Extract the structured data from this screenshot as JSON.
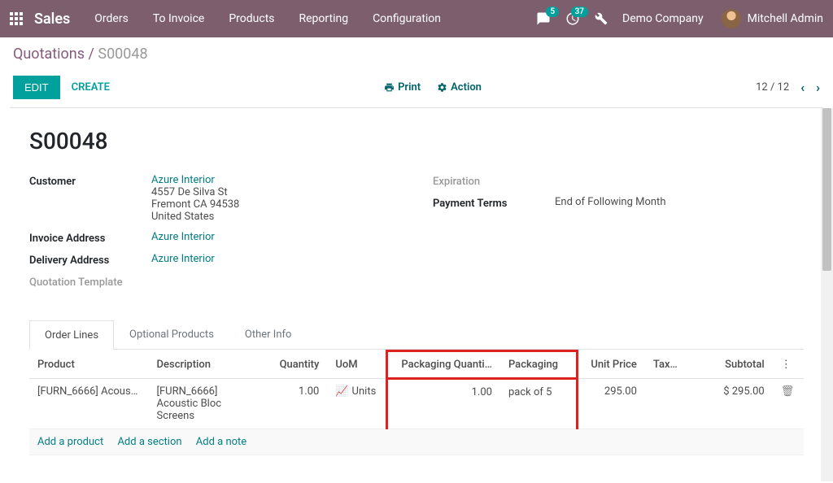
{
  "nav": {
    "brand": "Sales",
    "items": [
      "Orders",
      "To Invoice",
      "Products",
      "Reporting",
      "Configuration"
    ],
    "msg_badge": "5",
    "activity_badge": "37",
    "company": "Demo Company",
    "user": "Mitchell Admin"
  },
  "breadcrumb": {
    "root": "Quotations",
    "sep": " / ",
    "current": "S00048"
  },
  "buttons": {
    "edit": "EDIT",
    "create": "CREATE",
    "print": "Print",
    "action": "Action"
  },
  "pager": {
    "text": "12 / 12"
  },
  "record": {
    "title": "S00048",
    "customer_label": "Customer",
    "customer_link": "Azure Interior",
    "customer_addr1": "4557 De Silva St",
    "customer_addr2": "Fremont CA 94538",
    "customer_addr3": "United States",
    "invoice_label": "Invoice Address",
    "invoice_link": "Azure Interior",
    "delivery_label": "Delivery Address",
    "delivery_link": "Azure Interior",
    "template_label": "Quotation Template",
    "expiration_label": "Expiration",
    "terms_label": "Payment Terms",
    "terms_value": "End of Following Month"
  },
  "tabs": [
    "Order Lines",
    "Optional Products",
    "Other Info"
  ],
  "table": {
    "headers": {
      "product": "Product",
      "description": "Description",
      "quantity": "Quantity",
      "uom": "UoM",
      "pkg_qty": "Packaging Quanti…",
      "pkg": "Packaging",
      "unit_price": "Unit Price",
      "tax": "Tax…",
      "subtotal": "Subtotal"
    },
    "row": {
      "product": "[FURN_6666] Acoust…",
      "description": "[FURN_6666] Acoustic Bloc Screens",
      "quantity": "1.00",
      "uom": "Units",
      "pkg_qty": "1.00",
      "pkg": "pack of 5",
      "unit_price": "295.00",
      "tax": "",
      "subtotal": "$ 295.00"
    },
    "add_product": "Add a product",
    "add_section": "Add a section",
    "add_note": "Add a note"
  }
}
